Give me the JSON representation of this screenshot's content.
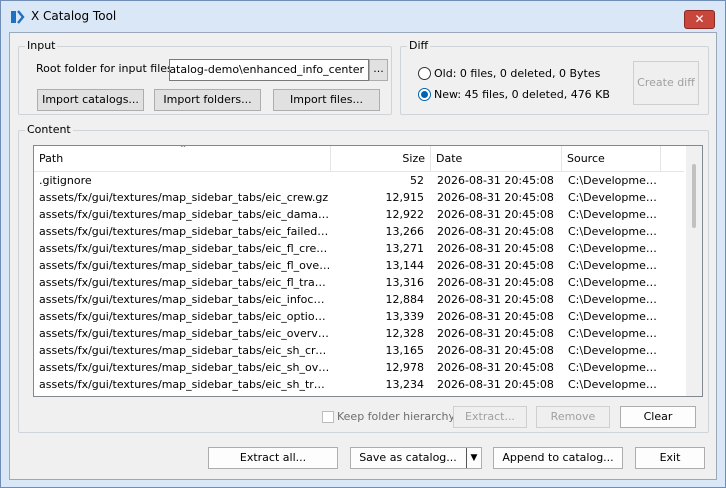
{
  "window": {
    "title": "X Catalog Tool",
    "close_label": "✕"
  },
  "input": {
    "group_title": "Input",
    "root_label": "Root folder for input files:",
    "root_value": "\\catalog-demo\\enhanced_info_center",
    "browse_label": "...",
    "import_catalogs": "Import catalogs...",
    "import_folders": "Import folders...",
    "import_files": "Import files..."
  },
  "diff": {
    "group_title": "Diff",
    "old_label": "Old: 0 files, 0 deleted, 0 Bytes",
    "new_label": "New: 45 files, 0 deleted, 476 KB",
    "selected": "new",
    "create_label": "Create diff"
  },
  "content": {
    "group_title": "Content",
    "columns": {
      "path": "Path",
      "size": "Size",
      "date": "Date",
      "source": "Source"
    },
    "sort_indicator": "⌃",
    "rows": [
      {
        "path": ".gitignore",
        "size": "52",
        "date": "2026-08-31 20:45:08",
        "source": "C:\\Developmen..."
      },
      {
        "path": "assets/fx/gui/textures/map_sidebar_tabs/eic_crew.gz",
        "size": "12,915",
        "date": "2026-08-31 20:45:08",
        "source": "C:\\Developmen..."
      },
      {
        "path": "assets/fx/gui/textures/map_sidebar_tabs/eic_damaged.gz",
        "size": "12,922",
        "date": "2026-08-31 20:45:08",
        "source": "C:\\Developmen..."
      },
      {
        "path": "assets/fx/gui/textures/map_sidebar_tabs/eic_failed.gz",
        "size": "13,266",
        "date": "2026-08-31 20:45:08",
        "source": "C:\\Developmen..."
      },
      {
        "path": "assets/fx/gui/textures/map_sidebar_tabs/eic_fl_crew.gz",
        "size": "13,271",
        "date": "2026-08-31 20:45:08",
        "source": "C:\\Developmen..."
      },
      {
        "path": "assets/fx/gui/textures/map_sidebar_tabs/eic_fl_overvie...",
        "size": "13,144",
        "date": "2026-08-31 20:45:08",
        "source": "C:\\Developmen..."
      },
      {
        "path": "assets/fx/gui/textures/map_sidebar_tabs/eic_fl_trade.gz",
        "size": "13,316",
        "date": "2026-08-31 20:45:08",
        "source": "C:\\Developmen..."
      },
      {
        "path": "assets/fx/gui/textures/map_sidebar_tabs/eic_infocenter.gz",
        "size": "12,884",
        "date": "2026-08-31 20:45:08",
        "source": "C:\\Developmen..."
      },
      {
        "path": "assets/fx/gui/textures/map_sidebar_tabs/eic_options.gz",
        "size": "13,339",
        "date": "2026-08-31 20:45:08",
        "source": "C:\\Developmen..."
      },
      {
        "path": "assets/fx/gui/textures/map_sidebar_tabs/eic_overview.gz",
        "size": "12,328",
        "date": "2026-08-31 20:45:08",
        "source": "C:\\Developmen..."
      },
      {
        "path": "assets/fx/gui/textures/map_sidebar_tabs/eic_sh_crew.gz",
        "size": "13,165",
        "date": "2026-08-31 20:45:08",
        "source": "C:\\Developmen..."
      },
      {
        "path": "assets/fx/gui/textures/map_sidebar_tabs/eic_sh_overvie...",
        "size": "12,978",
        "date": "2026-08-31 20:45:08",
        "source": "C:\\Developmen..."
      },
      {
        "path": "assets/fx/gui/textures/map_sidebar_tabs/eic_sh_trade.gz",
        "size": "13,234",
        "date": "2026-08-31 20:45:08",
        "source": "C:\\Developmen..."
      }
    ],
    "keep_hierarchy_label": "Keep folder hierarchy",
    "extract_label": "Extract...",
    "remove_label": "Remove",
    "clear_label": "Clear"
  },
  "footer": {
    "extract_all": "Extract all...",
    "save_as_catalog": "Save as catalog...",
    "save_dropdown": "▼",
    "append_to_catalog": "Append to catalog...",
    "exit": "Exit"
  },
  "colors": {
    "accent": "#0063b1",
    "title_bg": "#d9e7f7",
    "close": "#c9463d"
  },
  "icons": {
    "app": "x-catalog-app-icon",
    "close": "close-icon",
    "sort": "sort-up-icon",
    "dropdown": "chevron-down-icon"
  }
}
